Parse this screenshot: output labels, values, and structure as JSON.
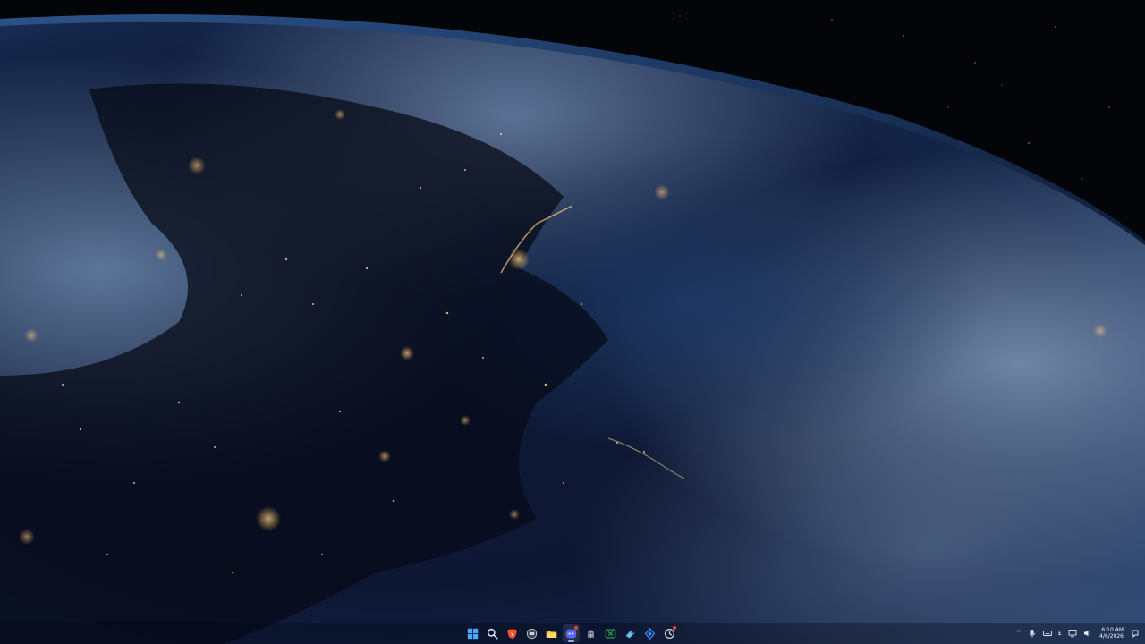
{
  "desktop": {
    "wallpaper": "earth-at-night-from-orbit"
  },
  "taskbar": {
    "accent": "#7fb2ff",
    "pinned": [
      {
        "name": "start-button",
        "icon": "windows-logo-icon",
        "color": "#4aa8ff"
      },
      {
        "name": "search-button",
        "icon": "search-icon",
        "color": "#e8eef8"
      },
      {
        "name": "brave-browser-button",
        "icon": "brave-lion-icon",
        "color": "#fb542b"
      },
      {
        "name": "task-view-button",
        "icon": "task-view-icon",
        "color": "#c9d2e0"
      },
      {
        "name": "file-explorer-button",
        "icon": "folder-icon",
        "color": "#f5c542"
      },
      {
        "name": "discord-button",
        "icon": "discord-icon",
        "color": "#5865f2"
      },
      {
        "name": "app-button-1",
        "icon": "ghost-app-icon",
        "color": "#aeb6c4"
      },
      {
        "name": "xbox-button",
        "icon": "xbox-icon",
        "color": "#2fa84f"
      },
      {
        "name": "steam-button",
        "icon": "steam-icon",
        "color": "#66c0f4"
      },
      {
        "name": "app-button-2",
        "icon": "diamond-app-icon",
        "color": "#3a8dff"
      },
      {
        "name": "app-button-3",
        "icon": "circle-app-icon",
        "color": "#d9dde6"
      }
    ],
    "tray": {
      "show_hidden_label": "^",
      "keyboard_label": "£",
      "time": "6:10 AM",
      "date": "4/6/2026"
    }
  }
}
